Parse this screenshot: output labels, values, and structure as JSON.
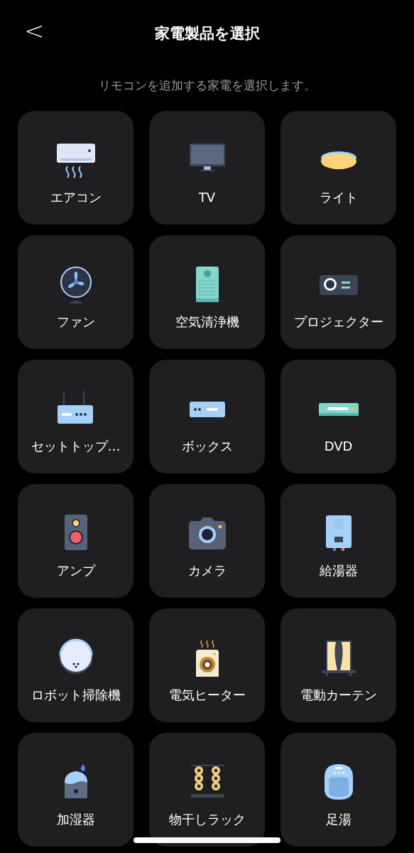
{
  "header": {
    "back": "<",
    "title": "家電製品を選択"
  },
  "subtitle": "リモコンを追加する家電を選択します。",
  "devices": [
    {
      "label": "エアコン"
    },
    {
      "label": "TV"
    },
    {
      "label": "ライト"
    },
    {
      "label": "ファン"
    },
    {
      "label": "空気清浄機"
    },
    {
      "label": "プロジェクター"
    },
    {
      "label": "セットトップ…"
    },
    {
      "label": "ボックス"
    },
    {
      "label": "DVD"
    },
    {
      "label": "アンプ"
    },
    {
      "label": "カメラ"
    },
    {
      "label": "給湯器"
    },
    {
      "label": "ロボット掃除機"
    },
    {
      "label": "電気ヒーター"
    },
    {
      "label": "電動カーテン"
    },
    {
      "label": "加湿器"
    },
    {
      "label": "物干しラック"
    },
    {
      "label": "足湯"
    }
  ]
}
